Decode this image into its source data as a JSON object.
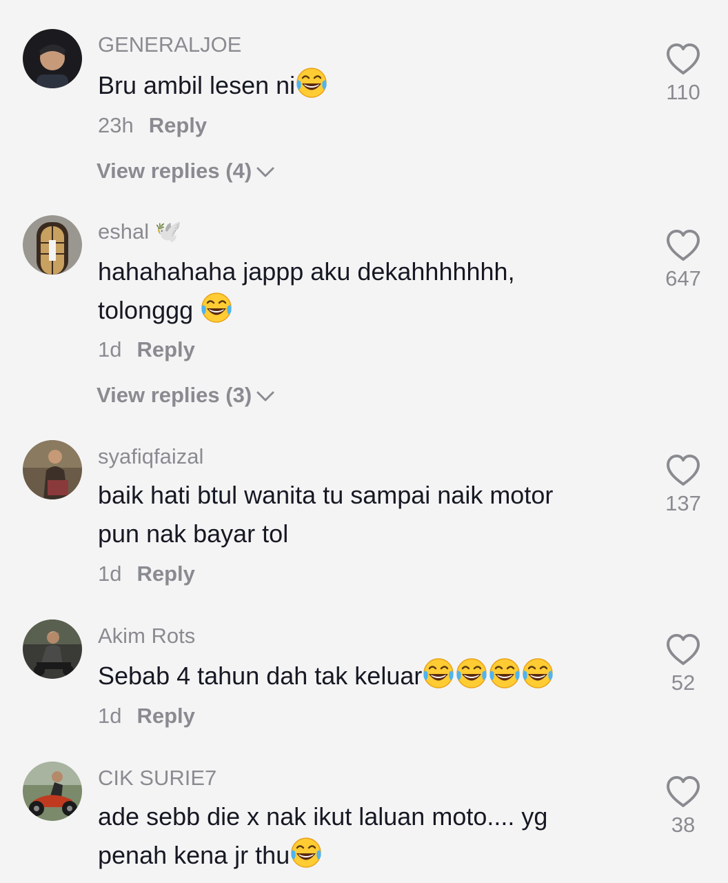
{
  "comments": [
    {
      "username": "GENERALJOE",
      "text": "Bru ambil lesen ni",
      "emoji_count": 1,
      "time": "23h",
      "reply_label": "Reply",
      "view_replies": "View replies (4)",
      "likes": "110"
    },
    {
      "username": "eshal",
      "username_badge": "🕊️",
      "text_line1": "hahahahaha jappp aku dekahhhhhhh,",
      "text_line2": "tolonggg",
      "emoji_count": 1,
      "time": "1d",
      "reply_label": "Reply",
      "view_replies": "View replies (3)",
      "likes": "647"
    },
    {
      "username": "syafiqfaizal",
      "text_line1": "baik hati btul wanita tu sampai naik motor",
      "text_line2": "pun nak bayar tol",
      "time": "1d",
      "reply_label": "Reply",
      "likes": "137"
    },
    {
      "username": "Akim Rots",
      "text": "Sebab 4 tahun dah tak keluar",
      "emoji_count": 4,
      "time": "1d",
      "reply_label": "Reply",
      "likes": "52"
    },
    {
      "username": "CIK SURIE7",
      "text_line1": "ade sebb die x nak ikut laluan moto.... yg",
      "text_line2": "penah kena jr thu",
      "emoji_count": 1,
      "likes": "38"
    }
  ],
  "icons": {
    "like": "heart-outline-icon",
    "expand": "chevron-down-icon",
    "emoji": "face-with-tears-of-joy"
  },
  "colors": {
    "background": "#f4f4f4",
    "text": "#161823",
    "secondary": "#8a8b91"
  }
}
